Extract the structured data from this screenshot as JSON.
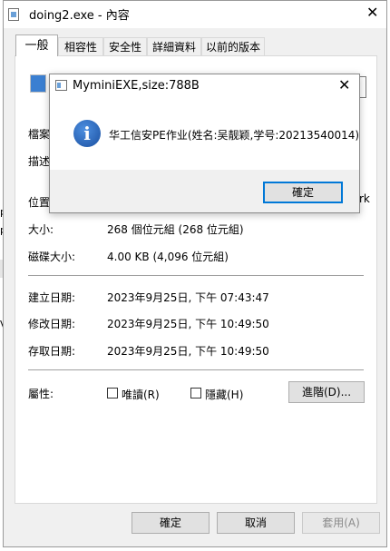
{
  "background": {
    "left_fragments": [
      "p",
      "p",
      "V"
    ],
    "right_fragment": "rk"
  },
  "window": {
    "title": "doing2.exe - 內容",
    "close_glyph": "✕",
    "tabs": [
      "一般",
      "相容性",
      "安全性",
      "詳細資料",
      "以前的版本"
    ]
  },
  "general": {
    "file_type_label": "檔案",
    "description_label": "描述",
    "location_label": "位置",
    "size_label": "大小:",
    "size_value": "268 個位元組 (268 位元組)",
    "disk_size_label": "磁碟大小:",
    "disk_size_value": "4.00 KB (4,096 位元組)",
    "created_label": "建立日期:",
    "created_value": "2023年9月25日, 下午 07:43:47",
    "modified_label": "修改日期:",
    "modified_value": "2023年9月25日, 下午 10:49:50",
    "accessed_label": "存取日期:",
    "accessed_value": "2023年9月25日, 下午 10:49:50",
    "attributes_label": "屬性:",
    "readonly_label": "唯讀(R)",
    "hidden_label": "隱藏(H)",
    "advanced_button": "進階(D)..."
  },
  "buttons": {
    "ok": "確定",
    "cancel": "取消",
    "apply": "套用(A)"
  },
  "dialog": {
    "title": "MyminiEXE,size:788B",
    "message": "华工信安PE作业(姓名:吴靓颖,学号:20213540014)",
    "ok": "確定",
    "close_glyph": "✕",
    "info_glyph": "i"
  }
}
